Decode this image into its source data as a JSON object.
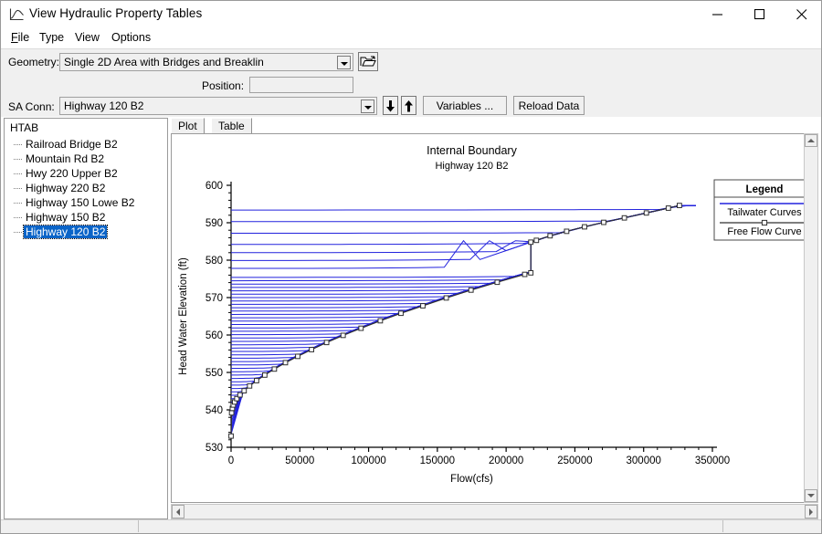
{
  "window": {
    "title": "View Hydraulic Property Tables",
    "icon": "chart-curve-icon",
    "minimize": "minimize-icon",
    "maximize": "maximize-icon",
    "close": "close-icon"
  },
  "menu": {
    "items": [
      {
        "label": "File",
        "accel": "F"
      },
      {
        "label": "Type",
        "accel": "T"
      },
      {
        "label": "View",
        "accel": "V"
      },
      {
        "label": "Options",
        "accel": "O"
      }
    ]
  },
  "toolbar": {
    "geometry_label": "Geometry:",
    "geometry_value": "Single 2D Area with Bridges and Breaklin",
    "open_button_icon": "open-folder-icon",
    "position_label": "Position:",
    "position_value": "",
    "sa_conn_label": "SA Conn:",
    "sa_conn_value": "Highway 120     B2",
    "down_button_icon": "arrow-down-icon",
    "up_button_icon": "arrow-up-icon",
    "variables_button": "Variables ...",
    "reload_button": "Reload Data"
  },
  "tree": {
    "root": "HTAB",
    "items": [
      {
        "label": "Railroad Bridge  B2",
        "selected": false
      },
      {
        "label": "Mountain Rd       B2",
        "selected": false
      },
      {
        "label": "Hwy 220 Upper    B2",
        "selected": false
      },
      {
        "label": "Highway 220       B2",
        "selected": false
      },
      {
        "label": "Highway 150 Lowe B2",
        "selected": false
      },
      {
        "label": "Highway 150       B2",
        "selected": false
      },
      {
        "label": "Highway 120       B2",
        "selected": true
      }
    ]
  },
  "tabs": [
    {
      "label": "Plot",
      "active": true
    },
    {
      "label": "Table",
      "active": false
    }
  ],
  "chart_data": {
    "type": "line",
    "title": "Internal Boundary",
    "subtitle": "Highway 120     B2",
    "xlabel": "Flow(cfs)",
    "ylabel": "Head Water Elevation (ft)",
    "xlim": [
      0,
      350000
    ],
    "ylim": [
      530,
      600
    ],
    "xticks": [
      0,
      50000,
      100000,
      150000,
      200000,
      250000,
      300000,
      350000
    ],
    "xtick_labels": [
      "0",
      "50000",
      "100000",
      "150000",
      "200000",
      "250000",
      "300000",
      "350000"
    ],
    "x_minor_ticks_per_major": 4,
    "yticks": [
      530,
      540,
      550,
      560,
      570,
      580,
      590,
      600
    ],
    "ytick_labels": [
      "530",
      "540",
      "550",
      "560",
      "570",
      "580",
      "590",
      "600"
    ],
    "grid": false,
    "legend": {
      "title": "Legend",
      "position": "upper-right-outside",
      "entries": [
        {
          "label": "Tailwater Curves",
          "color": "#2222dd",
          "marker": "none"
        },
        {
          "label": "Free Flow Curve",
          "color": "#303030",
          "marker": "square"
        }
      ]
    },
    "series": [
      {
        "name": "Free Flow Curve",
        "color": "#303030",
        "marker": "square",
        "x": [
          0,
          400,
          900,
          1600,
          2600,
          4200,
          6500,
          9500,
          13500,
          18500,
          24500,
          31500,
          39500,
          48500,
          58500,
          69500,
          81500,
          94500,
          108500,
          123500,
          139500,
          156500,
          174500,
          193500,
          213500,
          218000,
          218000,
          222000,
          232000,
          244000,
          257000,
          271000,
          286000,
          302000,
          318000,
          326000
        ],
        "y": [
          533.0,
          539.2,
          540.4,
          541.3,
          542.1,
          543.0,
          544.0,
          545.1,
          546.4,
          547.8,
          549.3,
          550.9,
          552.6,
          554.3,
          556.1,
          558.0,
          559.9,
          561.8,
          563.8,
          565.8,
          567.8,
          569.9,
          572.0,
          574.1,
          576.2,
          576.6,
          584.8,
          585.3,
          586.5,
          587.7,
          588.9,
          590.1,
          591.3,
          592.6,
          593.9,
          594.6
        ]
      },
      {
        "name": "Tailwater Curves",
        "color": "#2222dd",
        "marker": "none",
        "note": "Family of ~55 near-horizontal head-water curves, one per tailwater stage from about 533 ft to 595 ft; each runs flat from zero flow and bends upward at the right where it merges with the free-flow curve.",
        "count": 55,
        "start_elevations": [
          533.2,
          534.0,
          534.9,
          535.8,
          536.7,
          537.6,
          538.5,
          539.4,
          540.3,
          541.2,
          542.1,
          543.0,
          543.9,
          544.8,
          545.7,
          546.6,
          547.5,
          548.4,
          549.3,
          550.2,
          551.1,
          552.0,
          552.9,
          553.8,
          554.7,
          555.6,
          556.5,
          557.4,
          558.3,
          559.2,
          560.1,
          561.0,
          561.9,
          562.8,
          563.7,
          564.6,
          565.5,
          566.4,
          567.3,
          568.2,
          569.1,
          570.0,
          570.9,
          571.8,
          572.7,
          573.6,
          574.5,
          575.4,
          577.8,
          579.9,
          582.0,
          584.2,
          587.2,
          590.3,
          593.4
        ]
      }
    ]
  },
  "scroll": {
    "v_up": "scroll-up-icon",
    "v_down": "scroll-down-icon",
    "h_left": "scroll-left-icon",
    "h_right": "scroll-right-icon"
  }
}
